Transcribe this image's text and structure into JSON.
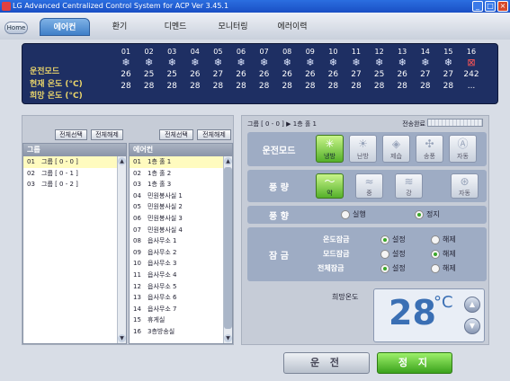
{
  "window": {
    "title": "LG Advanced Centralized Control System for ACP Ver 3.45.1"
  },
  "nav": {
    "home": "Home",
    "tabs": [
      "에어컨",
      "환기",
      "디멘드",
      "모니터링",
      "에러이력"
    ]
  },
  "status": {
    "labels": {
      "mode": "운전모드",
      "current": "현재 온도 (°C)",
      "target": "희망 온도 (°C)"
    },
    "units": [
      {
        "num": "01",
        "icon": "snowflake-icon",
        "cur": "26",
        "set": "28"
      },
      {
        "num": "02",
        "icon": "snowflake-icon",
        "cur": "25",
        "set": "28"
      },
      {
        "num": "03",
        "icon": "snowflake-icon",
        "cur": "25",
        "set": "28"
      },
      {
        "num": "04",
        "icon": "snowflake-icon",
        "cur": "26",
        "set": "28"
      },
      {
        "num": "05",
        "icon": "snowflake-icon",
        "cur": "27",
        "set": "28"
      },
      {
        "num": "06",
        "icon": "snowflake-icon",
        "cur": "26",
        "set": "28"
      },
      {
        "num": "07",
        "icon": "snowflake-icon",
        "cur": "26",
        "set": "28"
      },
      {
        "num": "08",
        "icon": "snowflake-icon",
        "cur": "26",
        "set": "28"
      },
      {
        "num": "09",
        "icon": "snowflake-icon",
        "cur": "26",
        "set": "28"
      },
      {
        "num": "10",
        "icon": "snowflake-icon",
        "cur": "26",
        "set": "28"
      },
      {
        "num": "11",
        "icon": "snowflake-icon",
        "cur": "27",
        "set": "28"
      },
      {
        "num": "12",
        "icon": "snowflake-icon",
        "cur": "25",
        "set": "28"
      },
      {
        "num": "13",
        "icon": "snowflake-icon",
        "cur": "26",
        "set": "28"
      },
      {
        "num": "14",
        "icon": "snowflake-icon",
        "cur": "27",
        "set": "28"
      },
      {
        "num": "15",
        "icon": "snowflake-icon",
        "cur": "27",
        "set": "28"
      },
      {
        "num": "16",
        "icon": "error-icon",
        "cur": "242",
        "set": "..."
      }
    ]
  },
  "left": {
    "group_select_all": "전체선택",
    "group_clear_all": "전체해제",
    "ac_select_all": "전체선택",
    "ac_clear_all": "전체해제",
    "group_header": "그룹",
    "ac_header": "에어컨",
    "groups": [
      {
        "n": "01",
        "name": "그룹 [ 0 - 0 ]"
      },
      {
        "n": "02",
        "name": "그룹 [ 0 - 1 ]"
      },
      {
        "n": "03",
        "name": "그룹 [ 0 - 2 ]"
      }
    ],
    "units": [
      {
        "n": "01",
        "name": "1층 홀 1"
      },
      {
        "n": "02",
        "name": "1층 홀 2"
      },
      {
        "n": "03",
        "name": "1층 홀 3"
      },
      {
        "n": "04",
        "name": "민원봉사실 1"
      },
      {
        "n": "05",
        "name": "민원봉사실 2"
      },
      {
        "n": "06",
        "name": "민원봉사실 3"
      },
      {
        "n": "07",
        "name": "민원봉사실 4"
      },
      {
        "n": "08",
        "name": "읍사무소 1"
      },
      {
        "n": "09",
        "name": "읍사무소 2"
      },
      {
        "n": "10",
        "name": "읍사무소 3"
      },
      {
        "n": "11",
        "name": "읍사무소 4"
      },
      {
        "n": "12",
        "name": "읍사무소 5"
      },
      {
        "n": "13",
        "name": "읍사무소 6"
      },
      {
        "n": "14",
        "name": "읍사무소 7"
      },
      {
        "n": "15",
        "name": "휴게실"
      },
      {
        "n": "16",
        "name": "3층방송실"
      }
    ]
  },
  "right": {
    "breadcrumb": "그룹 [ 0 - 0 ] ▶ 1층 홀 1",
    "transfer": "전송완료",
    "mode": {
      "title": "운전모드",
      "buttons": [
        "냉방",
        "난방",
        "제습",
        "송풍",
        "자동"
      ]
    },
    "fan": {
      "title": "풍  량",
      "buttons": [
        "약",
        "중",
        "강",
        "자동"
      ]
    },
    "swing": {
      "title": "풍  향",
      "on": "실행",
      "off": "정지"
    },
    "lock": {
      "title": "잠  금",
      "rows": [
        "온도잠금",
        "모드잠금",
        "전체잠금"
      ],
      "set": "설정",
      "release": "해제"
    },
    "target_label": "희망온도",
    "target_value": "28",
    "target_unit": "°C"
  },
  "actions": {
    "run": "운 전",
    "stop": "정 지"
  }
}
